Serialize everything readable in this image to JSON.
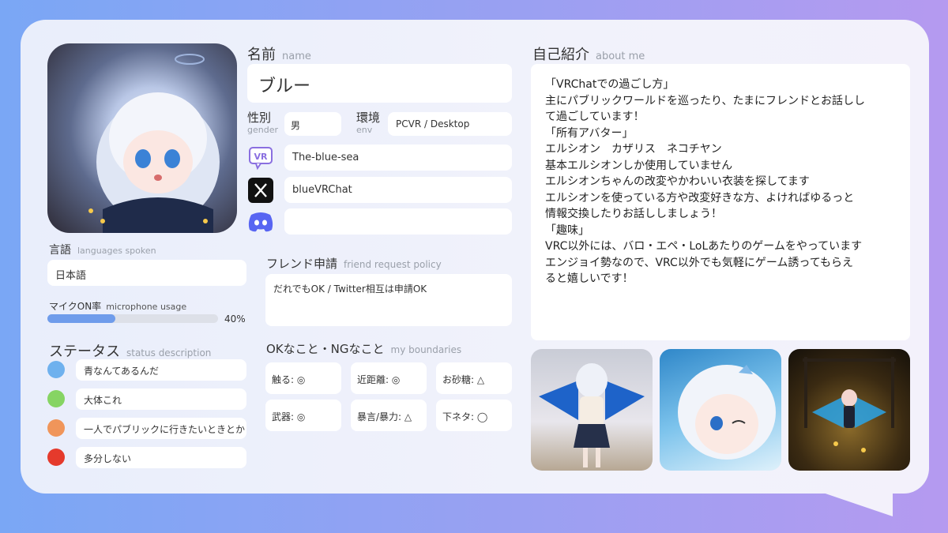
{
  "name": {
    "label_jp": "名前",
    "label_en": "name",
    "value": "ブルー"
  },
  "gender": {
    "label_jp": "性別",
    "label_en": "gender",
    "value": "男"
  },
  "env": {
    "label_jp": "環境",
    "label_en": "env",
    "value": "PCVR / Desktop"
  },
  "socials": {
    "vrchat": "The-blue-sea",
    "x": "blueVRChat",
    "discord": ""
  },
  "languages": {
    "label_jp": "言語",
    "label_en": "languages spoken",
    "value": "日本語"
  },
  "mic": {
    "label_jp": "マイクON率",
    "label_en": "microphone usage",
    "percent": 40,
    "percent_text": "40%"
  },
  "status": {
    "label_jp": "ステータス",
    "label_en": "status description",
    "items": [
      {
        "color": "#6fb1ee",
        "text": "青なんてあるんだ"
      },
      {
        "color": "#86d463",
        "text": "大体これ"
      },
      {
        "color": "#f0955a",
        "text": "一人でパブリックに行きたいときとか"
      },
      {
        "color": "#e53a2c",
        "text": "多分しない"
      }
    ]
  },
  "friend_request": {
    "label_jp": "フレンド申請",
    "label_en": "friend request policy",
    "value": "だれでもOK / Twitter相互は申請OK"
  },
  "boundaries": {
    "label_jp": "OKなこと・NGなこと",
    "label_en": "my boundaries",
    "items": [
      "触る: ◎",
      "近距離: ◎",
      "お砂糖: △",
      "武器: ◎",
      "暴言/暴力: △",
      "下ネタ: ◯"
    ]
  },
  "about": {
    "label_jp": "自己紹介",
    "label_en": "about me",
    "lines": [
      "「VRChatでの過ごし方」",
      "主にパブリックワールドを巡ったり、たまにフレンドとお話しし",
      "て過ごしています！",
      "「所有アバター」",
      "エルシオン　カザリス　ネコチヤン",
      "基本エルシオンしか使用していません",
      "エルシオンちゃんの改変やかわいい衣装を探してます",
      "エルシオンを使っている方や改変好きな方、よければゆるっと",
      "情報交換したりお話ししましょう！",
      "「趣味」",
      "VRC以外には、バロ・エペ・LoLあたりのゲームをやっています",
      "エンジョイ勢なので、VRC以外でも気軽にゲーム誘ってもらえ",
      "ると嬉しいです！"
    ]
  },
  "icons": {
    "vrchat": "vrchat-logo-icon",
    "x": "x-logo-icon",
    "discord": "discord-logo-icon"
  }
}
